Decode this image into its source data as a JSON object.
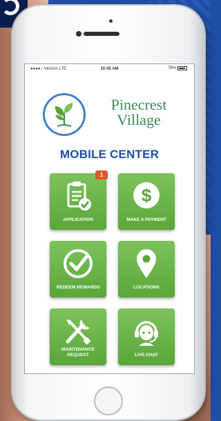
{
  "status_bar": {
    "carrier": "●●●●○ Verizon  LTE",
    "time": "10:45 AM",
    "battery": "78%"
  },
  "brand": {
    "line1": "Pinecrest",
    "line2": "Village"
  },
  "heading": "MOBILE CENTER",
  "tiles": [
    {
      "label": "APPLICATION",
      "icon": "clipboard-check-icon",
      "badge": "1"
    },
    {
      "label": "MAKE A PAYMENT",
      "icon": "dollar-circle-icon"
    },
    {
      "label": "REDEEM REWARDS",
      "icon": "checkmark-circle-icon"
    },
    {
      "label": "LOCATIONS",
      "icon": "map-pin-icon"
    },
    {
      "label": "MAINTENANCE REQUEST",
      "icon": "tools-icon"
    },
    {
      "label": "LIVE CHAT",
      "icon": "headset-agent-icon"
    }
  ],
  "colors": {
    "tile_green": "#6ab84a",
    "heading_blue": "#1d4fa0",
    "brand_green": "#3c8a57",
    "badge_orange": "#e0572a",
    "background_blue": "#1f4fa8"
  }
}
